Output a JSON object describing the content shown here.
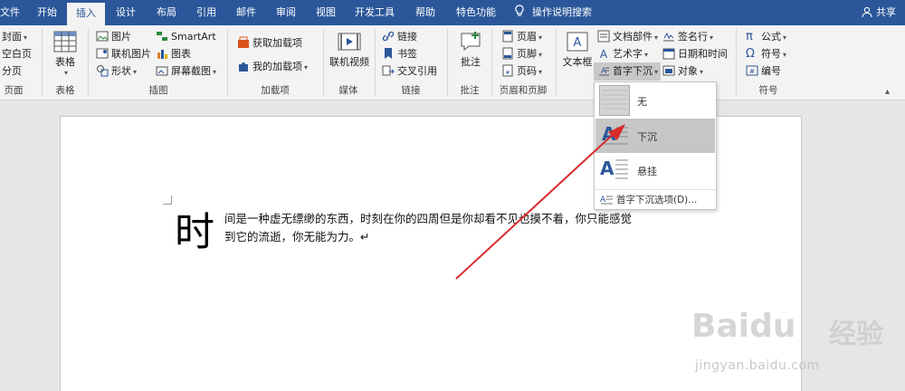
{
  "tabs": [
    "文件",
    "开始",
    "插入",
    "设计",
    "布局",
    "引用",
    "邮件",
    "审阅",
    "视图",
    "开发工具",
    "帮助",
    "特色功能"
  ],
  "tellme": "操作说明搜索",
  "share": "共享",
  "ribbon": {
    "pages": {
      "cover": "封面",
      "blank": "空白页",
      "pagebreak": "分页",
      "label": "页面"
    },
    "table": {
      "btn": "表格",
      "label": "表格"
    },
    "illustrations": {
      "picture": "图片",
      "online_picture": "联机图片",
      "shapes": "形状",
      "smartart": "SmartArt",
      "chart": "图表",
      "screenshot": "屏幕截图",
      "label": "插图"
    },
    "addins": {
      "get": "获取加载项",
      "my": "我的加载项",
      "label": "加载项"
    },
    "media": {
      "video": "联机视频",
      "label": "媒体"
    },
    "links": {
      "link": "链接",
      "bookmark": "书签",
      "crossref": "交叉引用",
      "label": "链接"
    },
    "comments": {
      "btn": "批注",
      "label": "批注"
    },
    "header_footer": {
      "header": "页眉",
      "footer": "页脚",
      "pagenum": "页码",
      "label": "页眉和页脚"
    },
    "text": {
      "textbox": "文本框",
      "quickparts": "文档部件",
      "wordart": "艺术字",
      "dropcap": "首字下沉",
      "signature": "签名行",
      "datetime": "日期和时间",
      "object": "对象"
    },
    "symbols": {
      "equation": "公式",
      "symbol": "符号",
      "number": "编号",
      "label": "符号"
    }
  },
  "dropdown": {
    "none": "无",
    "dropped": "下沉",
    "margin": "悬挂",
    "options": "首字下沉选项(D)..."
  },
  "doc": {
    "dropcap": "时",
    "line1": "间是一种虚无缥缈的东西，时刻在你的四周但是你却看不见也摸不着，你只能感觉",
    "line2": "到它的流逝，你无能为力。↵"
  },
  "watermark": {
    "brand": "Baidu",
    "cn": "经验",
    "url": "jingyan.baidu.com"
  },
  "colors": {
    "accent": "#2b579a",
    "arrow": "#d92b2b"
  }
}
